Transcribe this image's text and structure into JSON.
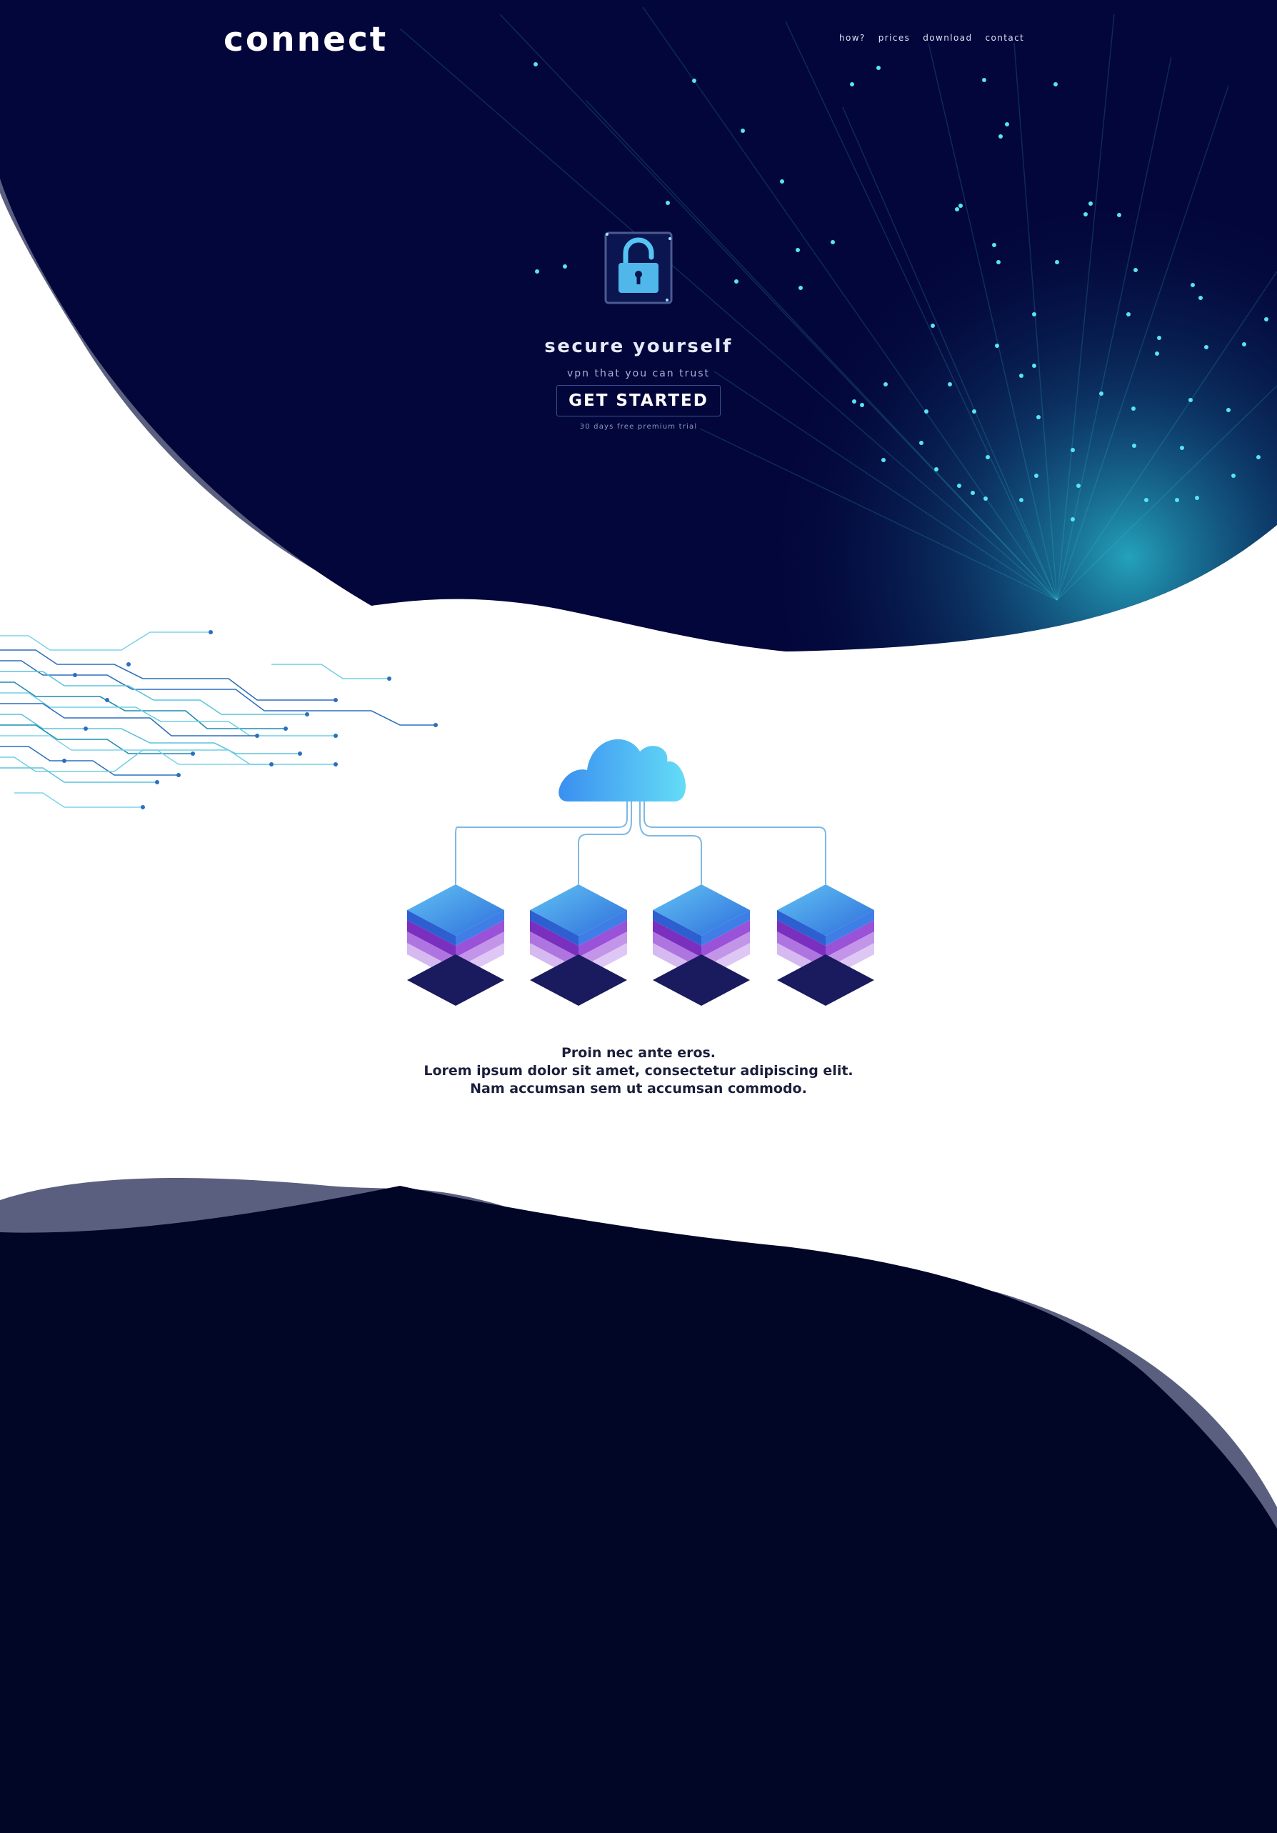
{
  "brand": {
    "logo": "connect"
  },
  "nav": {
    "items": [
      {
        "label": "how?"
      },
      {
        "label": "prices"
      },
      {
        "label": "download"
      },
      {
        "label": "contact"
      }
    ]
  },
  "hero": {
    "title": "secure yourself",
    "subtitle": "vpn that you can trust",
    "cta_label": "GET STARTED",
    "trial_note": "30 days free premium trial"
  },
  "features": {
    "line1": "Proin nec ante eros.",
    "line2": "Lorem ipsum dolor sit amet, consectetur adipiscing elit.",
    "line3": "Nam accumsan sem ut accumsan commodo."
  },
  "colors": {
    "navy": "#03063a",
    "dark_navy": "#010526",
    "accent_cyan": "#58e3f7",
    "server_blue": "#3a82e6",
    "server_purple": "#8b3fc9",
    "wave_shadow": "#5a5f7f"
  },
  "icons": {
    "hero_icon": "padlock-icon",
    "illustration": "cloud-servers-illustration",
    "decoration": "circuit-lines"
  }
}
